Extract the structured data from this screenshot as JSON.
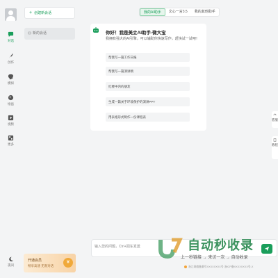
{
  "rail": {
    "items": [
      {
        "label": "对话",
        "icon": "chat-icon",
        "active": true
      },
      {
        "label": "创作",
        "icon": "feather-icon",
        "active": false
      },
      {
        "label": "模拟",
        "icon": "head-icon",
        "active": false
      },
      {
        "label": "绘画",
        "icon": "palette-icon",
        "active": false
      },
      {
        "label": "视频",
        "icon": "video-icon",
        "active": false
      },
      {
        "label": "更多",
        "icon": "grid-icon",
        "active": false
      }
    ],
    "theme_label": "夜间"
  },
  "sidebar": {
    "new_chat_label": "创建新会话",
    "history": [
      {
        "label": "新的会话"
      }
    ],
    "vip": {
      "title": "开通会员",
      "subtitle": "畅享高速 无限对话",
      "coin": "¥"
    }
  },
  "model_tabs": [
    {
      "label": "我的AI助手",
      "active": true
    },
    {
      "label": "文心一言3.5",
      "active": false
    },
    {
      "label": "我的其他助手",
      "active": false
    }
  ],
  "welcome": {
    "title": "你好！我是美立AI助手-微大宝",
    "subtitle": "我拥有强大的AI引擎，可以辅助你快速写作，赶快试一试吧！",
    "prompts": [
      {
        "label": "帮我写一篇工作日报"
      },
      {
        "label": "帮我写一篇演讲稿"
      },
      {
        "label": "红楼中内的朋友"
      },
      {
        "label": "生成一篇关于环境保护的演讲PPT"
      },
      {
        "label": "用表格形式制作一份课程表"
      }
    ]
  },
  "side_floats": [
    {
      "label": "客服",
      "icon": "headset-icon"
    },
    {
      "label": "教程",
      "icon": "book-icon"
    }
  ],
  "input": {
    "placeholder": "输入您的问题，Ctrl+回车发送"
  },
  "footer": {
    "text": "浙江网络备案号XXXXXXXX号 浙ICP备XXXXXXXX号-X"
  },
  "watermark": {
    "title": "自动秒收录",
    "subtitle": "上一秒链接 → 来访一次 → 自动收录"
  },
  "colors": {
    "accent": "#1a9e5b",
    "background": "#f3f4f5",
    "vip_gradient_start": "#fcebd3",
    "vip_gradient_end": "#f8d3a6"
  }
}
